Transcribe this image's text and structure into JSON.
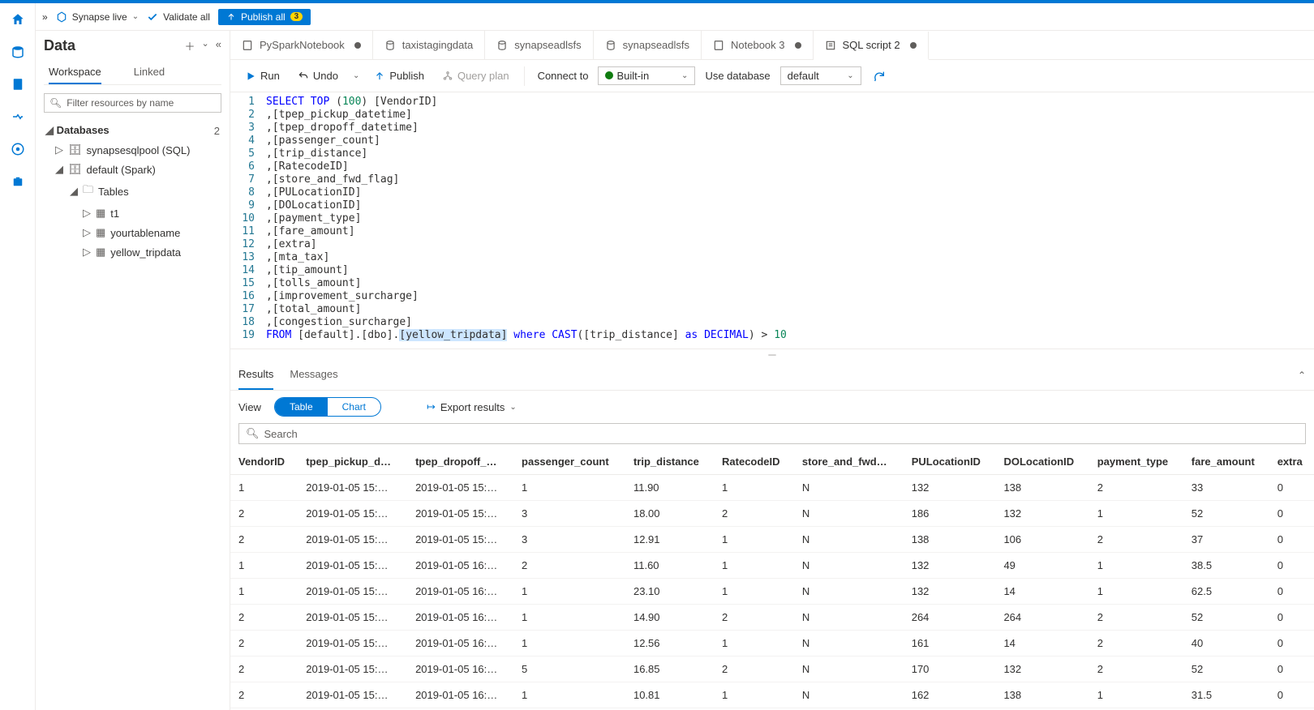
{
  "breadcrumb": {
    "chevron": "»",
    "synapse": "Synapse live",
    "validate": "Validate all",
    "publish": "Publish all",
    "publish_count": "3"
  },
  "data_panel": {
    "title": "Data",
    "tab_workspace": "Workspace",
    "tab_linked": "Linked",
    "filter_placeholder": "Filter resources by name",
    "databases_label": "Databases",
    "databases_count": "2",
    "tree": {
      "sqlpool": "synapsesqlpool (SQL)",
      "spark": "default (Spark)",
      "tables": "Tables",
      "t1": "t1",
      "t2": "yourtablename",
      "t3": "yellow_tripdata"
    }
  },
  "tabs": [
    {
      "label": "PySparkNotebook",
      "icon": "nb",
      "dirty": true
    },
    {
      "label": "taxistagingdata",
      "icon": "db"
    },
    {
      "label": "synapseadlsfs",
      "icon": "db"
    },
    {
      "label": "synapseadlsfs",
      "icon": "db"
    },
    {
      "label": "Notebook 3",
      "icon": "nb",
      "dirty": true
    },
    {
      "label": "SQL script 2",
      "icon": "sql",
      "dirty": true,
      "active": true
    }
  ],
  "toolbar": {
    "run": "Run",
    "undo": "Undo",
    "publish": "Publish",
    "query_plan": "Query plan",
    "connect_to": "Connect to",
    "builtin": "Built-in",
    "use_db": "Use database",
    "db_value": "default"
  },
  "code": [
    {
      "n": 1,
      "t": "SELECT TOP (100) [VendorID]"
    },
    {
      "n": 2,
      "t": ",[tpep_pickup_datetime]"
    },
    {
      "n": 3,
      "t": ",[tpep_dropoff_datetime]"
    },
    {
      "n": 4,
      "t": ",[passenger_count]"
    },
    {
      "n": 5,
      "t": ",[trip_distance]"
    },
    {
      "n": 6,
      "t": ",[RatecodeID]"
    },
    {
      "n": 7,
      "t": ",[store_and_fwd_flag]"
    },
    {
      "n": 8,
      "t": ",[PULocationID]"
    },
    {
      "n": 9,
      "t": ",[DOLocationID]"
    },
    {
      "n": 10,
      "t": ",[payment_type]"
    },
    {
      "n": 11,
      "t": ",[fare_amount]"
    },
    {
      "n": 12,
      "t": ",[extra]"
    },
    {
      "n": 13,
      "t": ",[mta_tax]"
    },
    {
      "n": 14,
      "t": ",[tip_amount]"
    },
    {
      "n": 15,
      "t": ",[tolls_amount]"
    },
    {
      "n": 16,
      "t": ",[improvement_surcharge]"
    },
    {
      "n": 17,
      "t": ",[total_amount]"
    },
    {
      "n": 18,
      "t": ",[congestion_surcharge]"
    },
    {
      "n": 19,
      "t": "FROM [default].[dbo].[yellow_tripdata] where CAST([trip_distance] as DECIMAL) > 10"
    }
  ],
  "results": {
    "tab_results": "Results",
    "tab_messages": "Messages",
    "view": "View",
    "table": "Table",
    "chart": "Chart",
    "export": "Export results",
    "search": "Search",
    "columns": [
      "VendorID",
      "tpep_pickup_d…",
      "tpep_dropoff_…",
      "passenger_count",
      "trip_distance",
      "RatecodeID",
      "store_and_fwd…",
      "PULocationID",
      "DOLocationID",
      "payment_type",
      "fare_amount",
      "extra"
    ],
    "rows": [
      [
        "1",
        "2019-01-05 15:…",
        "2019-01-05 15:…",
        "1",
        "11.90",
        "1",
        "N",
        "132",
        "138",
        "2",
        "33",
        "0"
      ],
      [
        "2",
        "2019-01-05 15:…",
        "2019-01-05 15:…",
        "3",
        "18.00",
        "2",
        "N",
        "186",
        "132",
        "1",
        "52",
        "0"
      ],
      [
        "2",
        "2019-01-05 15:…",
        "2019-01-05 15:…",
        "3",
        "12.91",
        "1",
        "N",
        "138",
        "106",
        "2",
        "37",
        "0"
      ],
      [
        "1",
        "2019-01-05 15:…",
        "2019-01-05 16:…",
        "2",
        "11.60",
        "1",
        "N",
        "132",
        "49",
        "1",
        "38.5",
        "0"
      ],
      [
        "1",
        "2019-01-05 15:…",
        "2019-01-05 16:…",
        "1",
        "23.10",
        "1",
        "N",
        "132",
        "14",
        "1",
        "62.5",
        "0"
      ],
      [
        "2",
        "2019-01-05 15:…",
        "2019-01-05 16:…",
        "1",
        "14.90",
        "2",
        "N",
        "264",
        "264",
        "2",
        "52",
        "0"
      ],
      [
        "2",
        "2019-01-05 15:…",
        "2019-01-05 16:…",
        "1",
        "12.56",
        "1",
        "N",
        "161",
        "14",
        "2",
        "40",
        "0"
      ],
      [
        "2",
        "2019-01-05 15:…",
        "2019-01-05 16:…",
        "5",
        "16.85",
        "2",
        "N",
        "170",
        "132",
        "2",
        "52",
        "0"
      ],
      [
        "2",
        "2019-01-05 15:…",
        "2019-01-05 16:…",
        "1",
        "10.81",
        "1",
        "N",
        "162",
        "138",
        "1",
        "31.5",
        "0"
      ]
    ]
  }
}
